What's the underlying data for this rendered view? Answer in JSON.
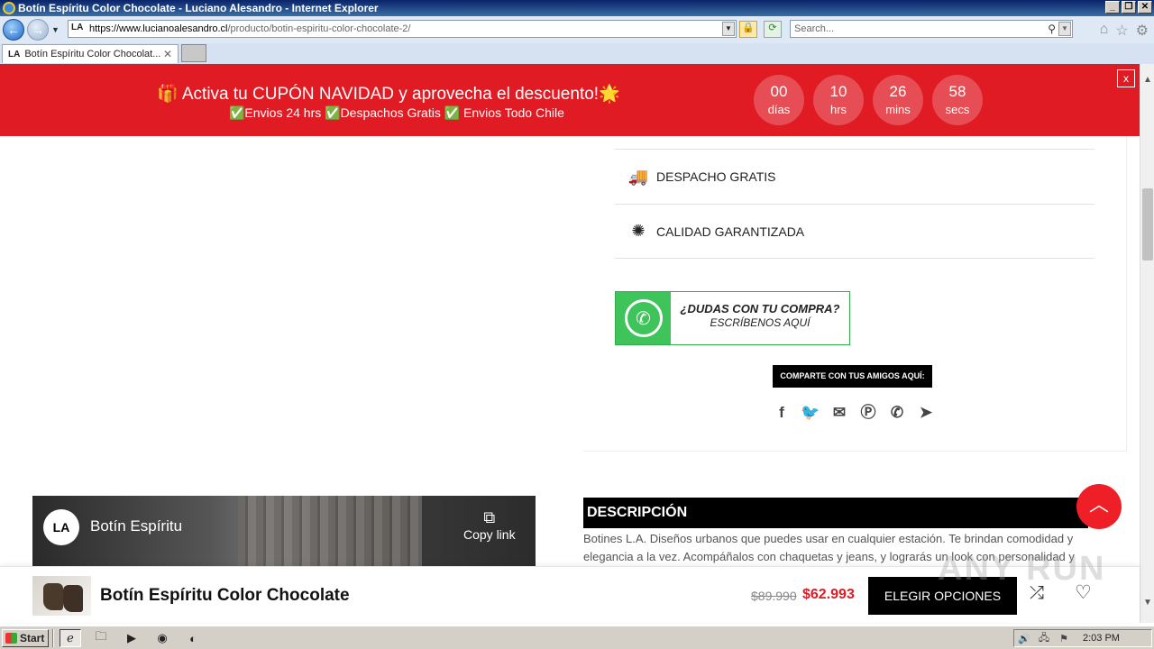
{
  "browser": {
    "window_title": "Botín Espíritu Color Chocolate - Luciano Alesandro - Internet Explorer",
    "url_host": "https://www.lucianoalesandro.cl",
    "url_path": "/producto/botin-espiritu-color-chocolate-2/",
    "search_placeholder": "Search...",
    "tab_title": "Botín Espíritu Color Chocolat...",
    "tab_favicon": "LA"
  },
  "promo": {
    "headline": "🎁 Activa tu CUPÓN NAVIDAD y aprovecha el descuento!🌟",
    "subline": "✅Envios 24 hrs ✅Despachos Gratis ✅ Envios Todo Chile",
    "countdown": [
      {
        "value": "00",
        "unit": "días"
      },
      {
        "value": "10",
        "unit": "hrs"
      },
      {
        "value": "26",
        "unit": "mins"
      },
      {
        "value": "58",
        "unit": "secs"
      }
    ],
    "close_label": "x",
    "bg_color": "#e01b24"
  },
  "features": [
    {
      "icon": "truck-icon",
      "label": "DESPACHO GRATIS"
    },
    {
      "icon": "badge-icon",
      "label": "CALIDAD GARANTIZADA"
    }
  ],
  "whatsapp": {
    "line1": "¿DUDAS CON TU COMPRA?",
    "line2": "ESCRÍBENOS AQUÍ"
  },
  "share": {
    "label": "COMPARTE CON TUS AMIGOS AQUÍ:",
    "networks": [
      "facebook-icon",
      "twitter-icon",
      "email-icon",
      "pinterest-icon",
      "whatsapp-icon",
      "telegram-icon"
    ]
  },
  "video": {
    "channel_logo": "LA",
    "title": "Botín Espíritu",
    "copy_link": "Copy link"
  },
  "description": {
    "heading": "DESCRIPCIÓN",
    "text": "Botines L.A. Diseños urbanos que puedes usar en cualquier estación. Te brindan comodidad y elegancia a la vez. Acompáñalos con chaquetas y jeans, y lograrás un look con personalidad y"
  },
  "sticky_bar": {
    "product_name": "Botín Espíritu Color Chocolate",
    "old_price": "$89.990",
    "new_price": "$62.993",
    "button_label": "ELEGIR OPCIONES"
  },
  "watermark": "ANY RUN",
  "taskbar": {
    "start_label": "Start",
    "clock": "2:03 PM"
  }
}
